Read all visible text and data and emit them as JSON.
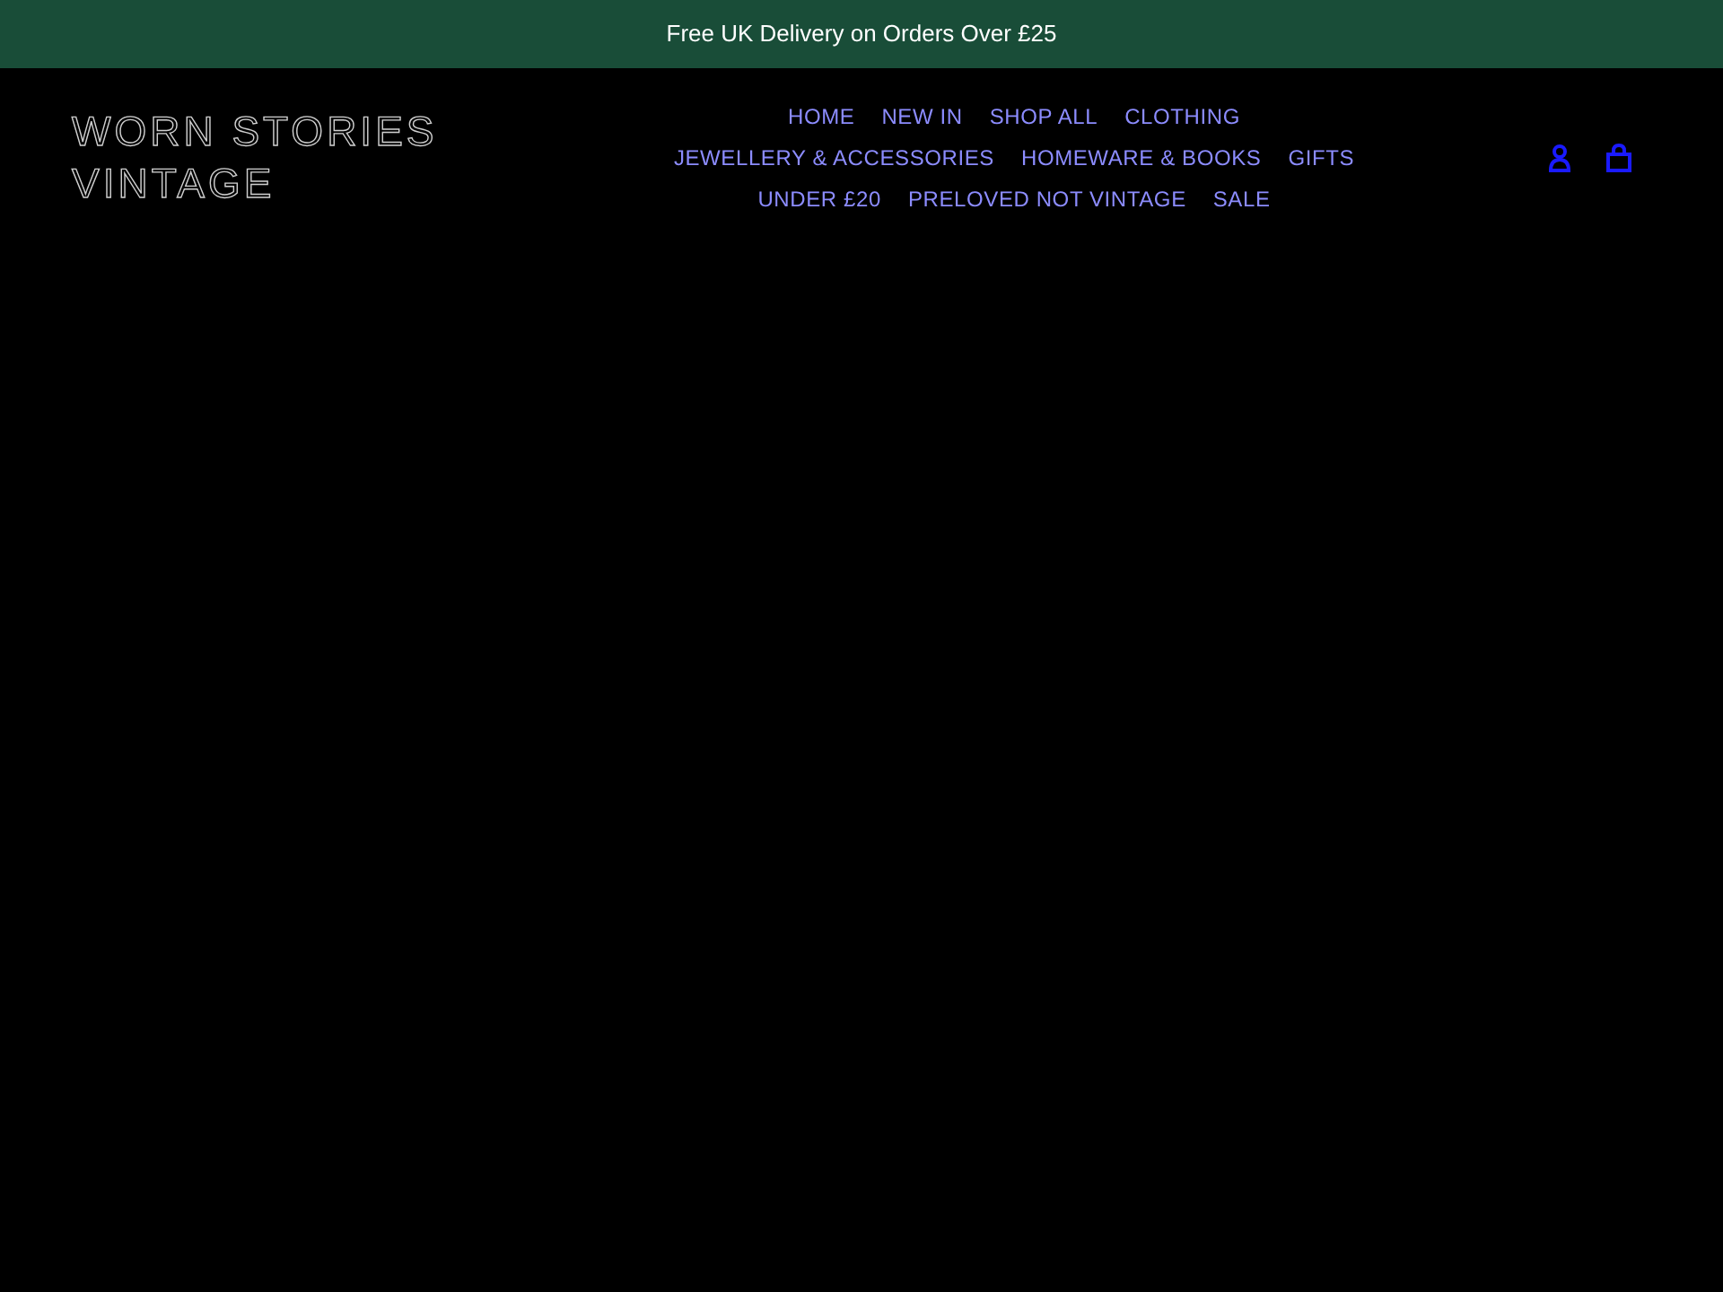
{
  "announcement": "Free UK Delivery on Orders Over £25",
  "logo": {
    "line_1": "WORN STORIES",
    "line_2": "VINTAGE"
  },
  "nav_rows": [
    [
      "HOME",
      "NEW IN",
      "SHOP ALL",
      "CLOTHING"
    ],
    [
      "JEWELLERY & ACCESSORIES",
      "HOMEWARE & BOOKS",
      "GIFTS"
    ],
    [
      "UNDER £20",
      "PRELOVED NOT VINTAGE",
      "SALE"
    ]
  ]
}
